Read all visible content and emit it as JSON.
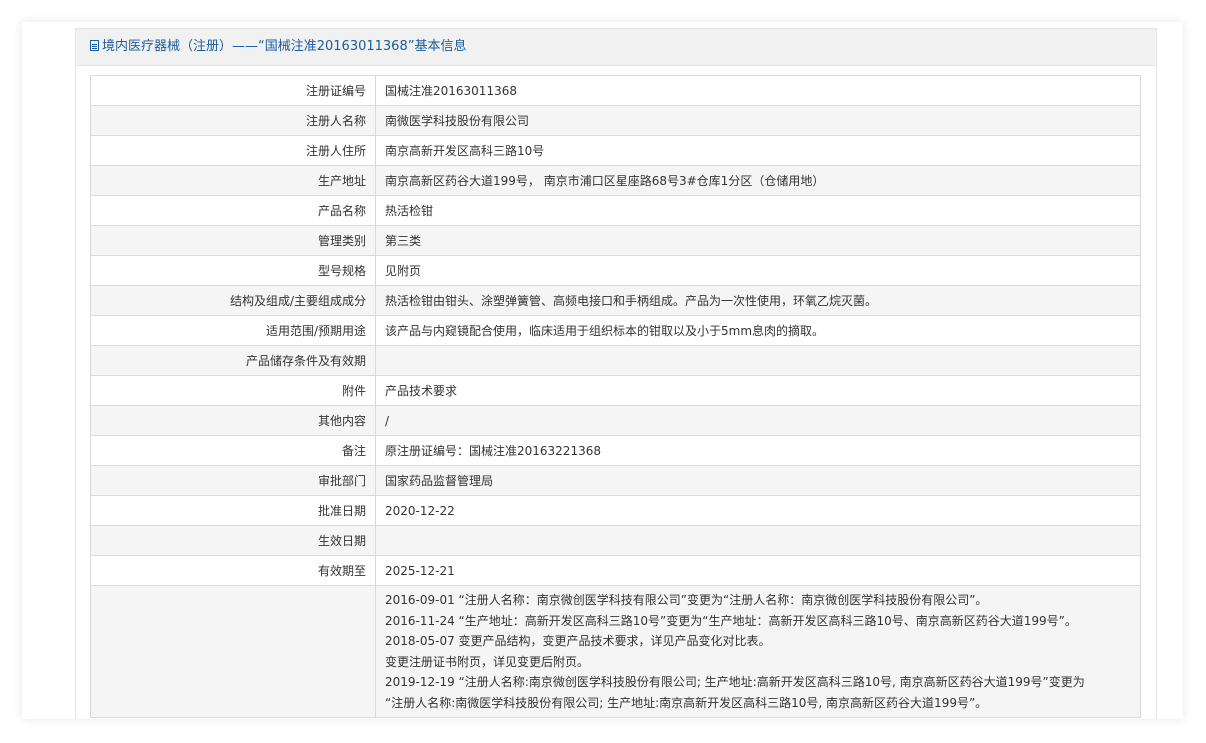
{
  "panel": {
    "title": "境内医疗器械（注册）——“国械注准20163011368”基本信息"
  },
  "rows": [
    {
      "label": "注册证编号",
      "value": "国械注准20163011368"
    },
    {
      "label": "注册人名称",
      "value": "南微医学科技股份有限公司"
    },
    {
      "label": "注册人住所",
      "value": "南京高新开发区高科三路10号"
    },
    {
      "label": "生产地址",
      "value": "南京高新区药谷大道199号， 南京市浦口区星座路68号3#仓库1分区（仓储用地）"
    },
    {
      "label": "产品名称",
      "value": "热活检钳"
    },
    {
      "label": "管理类别",
      "value": "第三类"
    },
    {
      "label": "型号规格",
      "value": "见附页"
    },
    {
      "label": "结构及组成/主要组成成分",
      "value": "热活检钳由钳头、涂塑弹簧管、高频电接口和手柄组成。产品为一次性使用，环氧乙烷灭菌。"
    },
    {
      "label": "适用范围/预期用途",
      "value": "该产品与内窥镜配合使用，临床适用于组织标本的钳取以及小于5mm息肉的摘取。"
    },
    {
      "label": "产品储存条件及有效期",
      "value": ""
    },
    {
      "label": "附件",
      "value": "产品技术要求"
    },
    {
      "label": "其他内容",
      "value": "/"
    },
    {
      "label": "备注",
      "value": "原注册证编号：国械注准20163221368"
    },
    {
      "label": "审批部门",
      "value": "国家药品监督管理局"
    },
    {
      "label": "批准日期",
      "value": "2020-12-22"
    },
    {
      "label": "生效日期",
      "value": ""
    },
    {
      "label": "有效期至",
      "value": "2025-12-21"
    }
  ],
  "change_history": {
    "label": "",
    "lines": [
      "2016-09-01 “注册人名称：南京微创医学科技有限公司”变更为“注册人名称：南京微创医学科技股份有限公司”。",
      "2016-11-24 “生产地址：高新开发区高科三路10号”变更为“生产地址：高新开发区高科三路10号、南京高新区药谷大道199号”。",
      "2018-05-07 变更产品结构，变更产品技术要求，详见产品变化对比表。",
      "变更注册证书附页，详见变更后附页。",
      "2019-12-19 “注册人名称:南京微创医学科技股份有限公司; 生产地址:高新开发区高科三路10号, 南京高新区药谷大道199号”变更为",
      "“注册人名称:南微医学科技股份有限公司; 生产地址:南京高新开发区高科三路10号, 南京高新区药谷大道199号”。"
    ]
  }
}
